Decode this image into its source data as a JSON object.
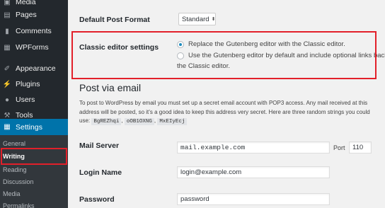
{
  "sidebar": {
    "items": [
      {
        "label": "Media",
        "icon": "media-icon"
      },
      {
        "label": "Pages",
        "icon": "pages-icon"
      },
      {
        "label": "Comments",
        "icon": "comments-icon"
      },
      {
        "label": "WPForms",
        "icon": "wpforms-icon"
      },
      {
        "label": "Appearance",
        "icon": "appearance-icon"
      },
      {
        "label": "Plugins",
        "icon": "plugins-icon"
      },
      {
        "label": "Users",
        "icon": "users-icon"
      },
      {
        "label": "Tools",
        "icon": "tools-icon"
      },
      {
        "label": "Settings",
        "icon": "settings-icon"
      }
    ],
    "submenu": [
      {
        "label": "General"
      },
      {
        "label": "Writing"
      },
      {
        "label": "Reading"
      },
      {
        "label": "Discussion"
      },
      {
        "label": "Media"
      },
      {
        "label": "Permalinks"
      }
    ]
  },
  "main": {
    "default_post_format": {
      "label": "Default Post Format",
      "value": "Standard",
      "caret": "⬍"
    },
    "classic_editor": {
      "label": "Classic editor settings",
      "option1": "Replace the Gutenberg editor with the Classic editor.",
      "option2_line1": "Use the Gutenberg editor by default and include optional links back to",
      "option2_line2": "the Classic editor."
    },
    "post_via_email": {
      "title": "Post via email",
      "desc_line1": "To post to WordPress by email you must set up a secret email account with POP3 access. Any mail received at this",
      "desc_line2": "address will be posted, so it’s a good idea to keep this address very secret. Here are three random strings you could",
      "desc_line3_prefix": "use:",
      "codes": [
        "BgREZhqi",
        "oOB1OXNG",
        "MxEIyEcj"
      ],
      "sep": ","
    },
    "mail_server": {
      "label": "Mail Server",
      "value": "mail.example.com",
      "port_label": "Port",
      "port_value": "110"
    },
    "login_name": {
      "label": "Login Name",
      "value": "login@example.com"
    },
    "password": {
      "label": "Password",
      "value": "password"
    }
  },
  "colors": {
    "accent": "#0073aa",
    "highlight": "#e2202a",
    "sidebar": "#23282d"
  }
}
